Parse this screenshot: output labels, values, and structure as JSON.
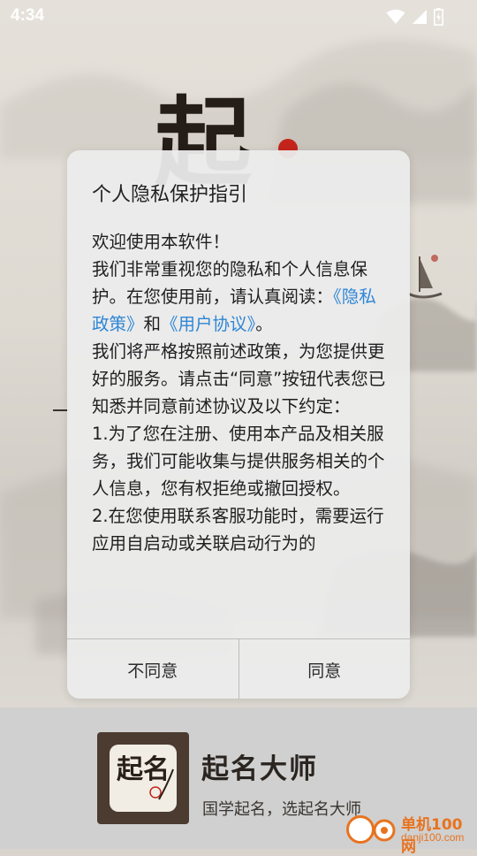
{
  "status_bar": {
    "time": "4:34"
  },
  "dialog": {
    "title": "个人隐私保护指引",
    "intro": "欢迎使用本软件！",
    "line2": "我们非常重视您的隐私和个人信息保护。在您使用前，请认真阅读：",
    "privacy_link": "《隐私政策》",
    "and": "和",
    "agreement_link": "《用户协议》",
    "period": "。",
    "paragraph2": "我们将严格按照前述政策，为您提供更好的服务。请点击“同意”按钮代表您已知悉并同意前述协议及以下约定：",
    "item1": "1.为了您在注册、使用本产品及相关服务，我们可能收集与提供服务相关的个人信息，您有权拒绝或撤回授权。",
    "item2": "2.在您使用联系客服功能时，需要运行应用自启动或关联启动行为的",
    "disagree_label": "不同意",
    "agree_label": "同意",
    "link_color": "#2f86d6"
  },
  "brand": {
    "logo_glyphs": "起名",
    "title": "起名大师",
    "subtitle": "国学起名，选起名大师"
  },
  "watermark": {
    "name": "单机100网",
    "url": "danji100.com",
    "accent_color": "#e8731f"
  },
  "background": {
    "glyph": "起"
  },
  "icons": {
    "wifi": "wifi-icon",
    "signal": "signal-icon",
    "battery": "battery-charging-icon"
  }
}
